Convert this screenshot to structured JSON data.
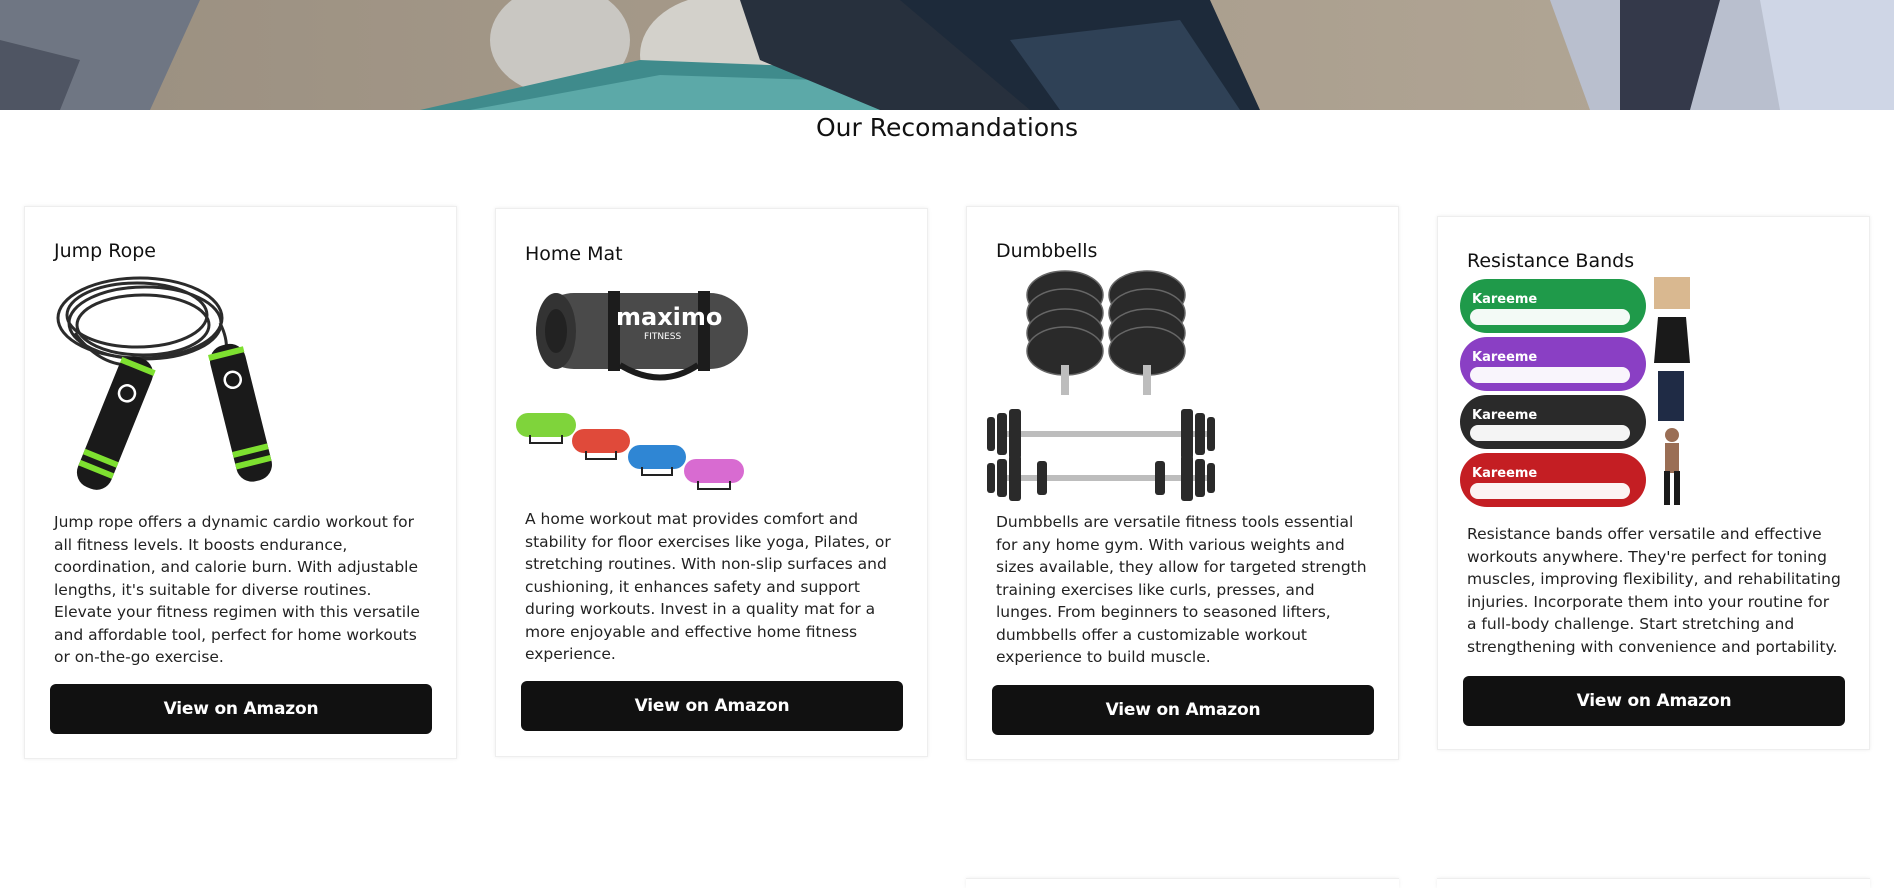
{
  "section": {
    "title": "Our Recomandations"
  },
  "cards": [
    {
      "title": "Jump Rope",
      "description": "Jump rope offers a dynamic cardio workout for all fitness levels. It boosts endurance, coordination, and calorie burn. With adjustable lengths, it's suitable for diverse routines. Elevate your fitness regimen with this versatile and affordable tool, perfect for home workouts or on-the-go exercise.",
      "button": "View on Amazon"
    },
    {
      "title": "Home Mat",
      "description": "A home workout mat provides comfort and stability for floor exercises like yoga, Pilates, or stretching routines. With non-slip surfaces and cushioning, it enhances safety and support during workouts. Invest in a quality mat for a more enjoyable and effective home fitness experience.",
      "button": "View on Amazon",
      "brand_text": "maximo",
      "brand_sub": "FITNESS"
    },
    {
      "title": "Dumbbells",
      "description": "Dumbbells are versatile fitness tools essential for any home gym. With various weights and sizes available, they allow for targeted strength training exercises like curls, presses, and lunges. From beginners to seasoned lifters, dumbbells offer a customizable workout experience to build muscle.",
      "button": "View on Amazon"
    },
    {
      "title": "Resistance Bands",
      "description": "Resistance bands offer versatile and effective workouts anywhere. They're perfect for toning muscles, improving flexibility, and rehabilitating injuries. Incorporate them into your routine for a full-body challenge. Start stretching and strengthening with convenience and portability.",
      "button": "View on Amazon",
      "brand_text": "Kareeme"
    }
  ],
  "colors": {
    "button_bg": "#111111",
    "button_text": "#ffffff",
    "card_border": "#eeeeee",
    "band_green": "#1f9a4a",
    "band_purple": "#8a3fc4",
    "band_black": "#2a2a2a",
    "band_red": "#c41e23",
    "jump_rope_accent": "#7ee030"
  }
}
